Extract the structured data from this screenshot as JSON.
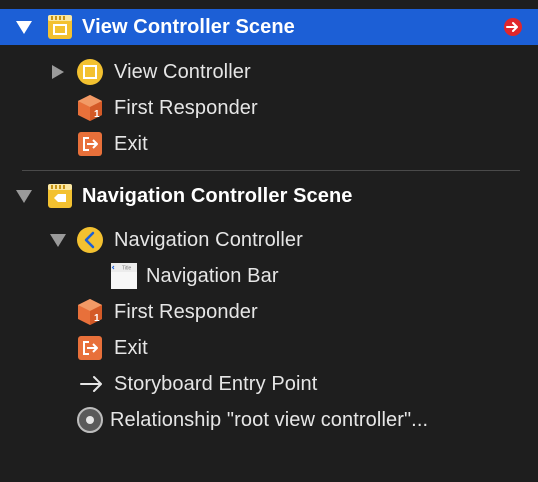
{
  "scenes": [
    {
      "title": "View Controller Scene",
      "items": {
        "view_controller": "View Controller",
        "first_responder": "First Responder",
        "exit": "Exit"
      }
    },
    {
      "title": "Navigation Controller Scene",
      "items": {
        "navigation_controller": "Navigation Controller",
        "navigation_bar": "Navigation Bar",
        "navigation_bar_thumb_text": "Title",
        "first_responder": "First Responder",
        "exit": "Exit",
        "entry_point": "Storyboard Entry Point",
        "relationship": "Relationship \"root view controller\"..."
      }
    }
  ],
  "icons": {
    "scene": "scene-icon",
    "view_controller": "view-controller-icon",
    "first_responder": "first-responder-cube-icon",
    "exit": "exit-icon",
    "navigation_controller": "navigation-controller-icon",
    "navigation_bar": "navigation-bar-icon",
    "entry_point": "arrow-right-icon",
    "relationship": "relationship-icon",
    "warning": "warning-arrow-icon"
  },
  "colors": {
    "selection": "#1c5fd6",
    "background": "#1e1e1e",
    "scene_yellow": "#f3c130",
    "responder_orange": "#e8703a",
    "warning_red": "#e0262c"
  }
}
